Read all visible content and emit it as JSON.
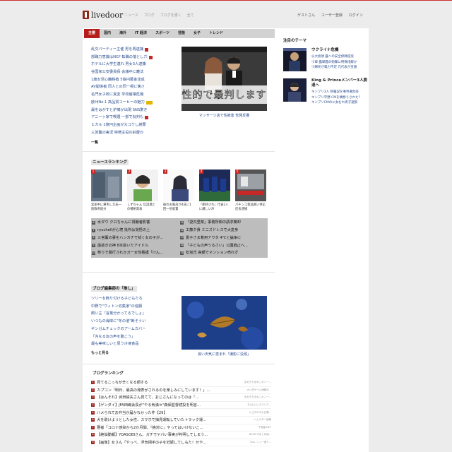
{
  "header": {
    "logo": "livedoor",
    "nav": [
      "ニュース",
      "ブログ",
      "ブログを書く",
      "全て"
    ],
    "user": [
      "ゲストさん",
      "ユーザー登録",
      "ログイン"
    ]
  },
  "tabs": [
    "主要",
    "国内",
    "海外",
    "IT 経済",
    "スポーツ",
    "芸能",
    "女子",
    "トレンド"
  ],
  "news": {
    "items": [
      {
        "text": "乱交パーティー主催 男を再逮捕",
        "badge": "red"
      },
      {
        "text": "部職力意識はNG? 転職の落とし穴",
        "badge": "red"
      },
      {
        "text": "ホテルに大学生連れ 男女3人逮捕",
        "badge": ""
      },
      {
        "text": "谷国家公安委員長 会議中に離法",
        "badge": ""
      },
      {
        "text": "1歳女児心臓移植 5億円募金達成",
        "badge": ""
      },
      {
        "text": "AV開係者 同人との同一視に懐さ",
        "badge": ""
      },
      {
        "text": "名門女子校に異変 学校崩壊危機",
        "badge": ""
      },
      {
        "text": "欧州No.1 高品質コーヒーの魅力",
        "badge": "yellow"
      },
      {
        "text": "最をはがすと炉痛が出現 SNS驚き",
        "badge": ""
      },
      {
        "text": "アニーヶ家で喫煙 一部で批判も",
        "badge": "red"
      },
      {
        "text": "ヒカル 1億円企画が大コケし謝罪",
        "badge": ""
      },
      {
        "text": "三笘薫の実況 特徴主役の鈴慶か",
        "badge": ""
      }
    ],
    "more": "一覧",
    "feature": {
      "overlay": "性的で最判します",
      "caption": "マッサージ店で性被害 告発反響"
    }
  },
  "ranking": {
    "title": "ニュースランキング",
    "thumbs": [
      {
        "num": "1",
        "caption": "実家中に帰宅し元夫一族数奇殺分"
      },
      {
        "num": "2",
        "caption": "しずちゃん 伝説連との補剣発表"
      },
      {
        "num": "3",
        "caption": "彼のお風呂が4日に1回一倍寂置"
      },
      {
        "num": "4",
        "caption": "「期待され」代表2人に厳しい声"
      },
      {
        "num": "5",
        "caption": "パチンコ景品買い供応 店長逮捕"
      }
    ],
    "list_left": [
      {
        "num": "6",
        "text": "水ダウ クロちゃんに視聴者影響"
      },
      {
        "num": "7",
        "text": "ryuchellが心境 批判は覚悟の上"
      },
      {
        "num": "8",
        "text": "三宮薫の妻をハンカチで拭く女の子が..."
      },
      {
        "num": "9",
        "text": "歯抜きの神 8本抜いたアイドル"
      },
      {
        "num": "10",
        "text": "祭りで暴行されかガー女性看護「けん..."
      }
    ],
    "list_right": [
      {
        "num": "11",
        "text": "「愛内里菜」事務所側の請求棄却"
      },
      {
        "num": "12",
        "text": "工藤夕貴 ミニズドレスで大変身"
      },
      {
        "num": "13",
        "text": "愛子さま着用アウタ 4℃と論争に"
      },
      {
        "num": "14",
        "text": "「子どもの声うるさい」公園廃止へ..."
      },
      {
        "num": "15",
        "text": "松坂氏 高額でマンション売れず"
      }
    ]
  },
  "blog": {
    "title": "ブログ編集部の「推し」",
    "items": [
      "ツリーを飾り付ける子どもたち",
      "中野で\"ヴィトン収集家\"の信願",
      "飼い主「言葉分かってるでしょ」",
      "いつもの海岸に\"冬の道\"断そうい",
      "ギンガムチェックのアームカバー",
      "「内なる友の声を聴こう」",
      "最も美味しいと思う冷凍食品"
    ],
    "more": "もっと見る",
    "feature_caption": "良い天気に恵まれ「撮影に没頭」"
  },
  "blog_ranking": {
    "title": "ブログランキング",
    "rows": [
      {
        "num": "1",
        "title": "見てるこっちが辛くなる顔する",
        "src": "まめきちまめこのニー..."
      },
      {
        "num": "2",
        "title": "カプコン「明日、最高の発表がされるのを楽しみにしています！」...",
        "src": "オレ的ゲーム速報＠..."
      },
      {
        "num": "3",
        "title": "【はんそれ】武田鉄矢さん見てて、おじさんになってのは「...",
        "src": "まめきちまめこのニー..."
      },
      {
        "num": "4",
        "title": "【ゲンダイ】JFA田嶋会長が\"やる気満々\"森保監督続投を明言...",
        "src": "なんJ(いいスラリア..."
      },
      {
        "num": "5",
        "title": "ハメられてお弁当が届かなかった件【29】",
        "src": "ヤゴダの干わ日曜..."
      },
      {
        "num": "6",
        "title": "犬を助けようとした女性、スマホで抽見運転していたトラック運...",
        "src": "ハムスター速報"
      },
      {
        "num": "7",
        "title": "悪者「コロナ感染から2か月間、『絶対に』やってはいけないこ...",
        "src": "子育園.NET"
      },
      {
        "num": "8",
        "title": "【絶悩動報】YOASOBIさん、ガチでヤバい事実が判明してしまう...",
        "src": "NEWS Bまとめ速..."
      },
      {
        "num": "9",
        "title": "【画像】女さん「やっべ、浮気相手の子を妊娠してしもた！せや...",
        "src": "Ruk. ニュー速ク..."
      }
    ]
  },
  "sidebar": {
    "title": "注目のテーマ",
    "topics": [
      {
        "head": "ウクライナ危機",
        "lines": [
          "仏大統領 露への安全保障提案",
          "ウ軍 露軍艦の砲撃に特殊措解か",
          "ウ綿民が電力不足 元代表が支援"
        ]
      },
      {
        "head": "King & Princeメンバー3人脱退へ",
        "lines": [
          "キンプリ3人 移籍説を事界選別答",
          "キンプリ平野 CMを構想うされた?",
          "キンプリCMのに女むれ男子避飲"
        ]
      }
    ]
  },
  "colors": {
    "accent": "#b71c1c",
    "link": "#2a4d8f",
    "tab_bar": "#d2d2d2",
    "rank_bg": "#bdbdbd"
  }
}
